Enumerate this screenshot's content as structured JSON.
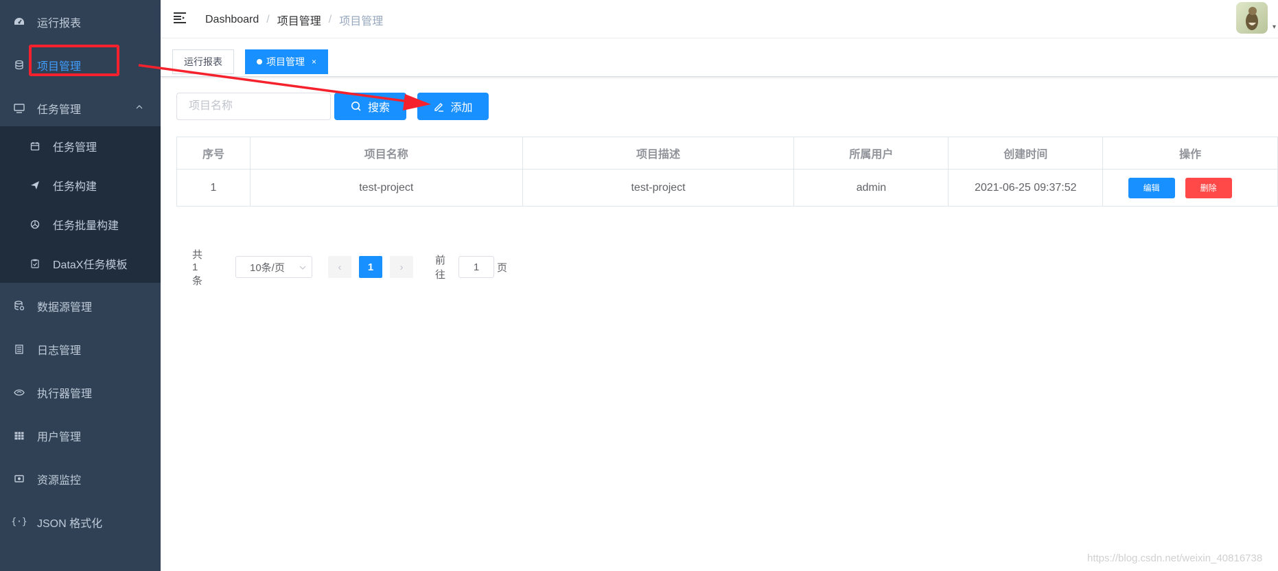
{
  "sidebar": {
    "items": [
      {
        "label": "运行报表",
        "icon": "dashboard-icon"
      },
      {
        "label": "项目管理",
        "icon": "database-icon"
      },
      {
        "label": "任务管理",
        "icon": "monitor-icon"
      },
      {
        "label": "数据源管理",
        "icon": "datasource-icon"
      },
      {
        "label": "日志管理",
        "icon": "document-icon"
      },
      {
        "label": "执行器管理",
        "icon": "eye-icon"
      },
      {
        "label": "用户管理",
        "icon": "table-icon"
      },
      {
        "label": "资源监控",
        "icon": "monitor-eye-icon"
      },
      {
        "label": "JSON 格式化",
        "icon": "braces-icon"
      }
    ],
    "sub_items": [
      {
        "label": "任务管理",
        "icon": "calendar-icon"
      },
      {
        "label": "任务构建",
        "icon": "send-icon"
      },
      {
        "label": "任务批量构建",
        "icon": "chart-icon"
      },
      {
        "label": "DataX任务模板",
        "icon": "clipboard-icon"
      }
    ]
  },
  "breadcrumb": [
    "Dashboard",
    "/",
    "项目管理",
    "/",
    "项目管理"
  ],
  "tags": [
    {
      "label": "运行报表"
    },
    {
      "label": "项目管理",
      "close": "×"
    }
  ],
  "filter": {
    "search_placeholder": "项目名称",
    "search_label": "搜索",
    "add_label": "添加"
  },
  "table": {
    "headers": [
      "序号",
      "项目名称",
      "项目描述",
      "所属用户",
      "创建时间",
      "操作"
    ],
    "rows": [
      {
        "index": "1",
        "name": "test-project",
        "description": "test-project",
        "user": "admin",
        "created": "2021-06-25 09:37:52",
        "edit": "编辑",
        "delete": "删除"
      }
    ]
  },
  "pagination": {
    "total": "共 1 条",
    "page_size": "10条/页",
    "prev": "‹",
    "current": "1",
    "next": "›",
    "goto": "前往",
    "goto_value": "1",
    "page_unit": "页"
  },
  "watermark": "https://blog.csdn.net/weixin_40816738",
  "colors": {
    "sidebar_bg": "#304156",
    "submenu_bg": "#1f2d3d",
    "primary": "#1890ff",
    "danger": "#ff4949",
    "annotation_red": "#f5222d"
  }
}
